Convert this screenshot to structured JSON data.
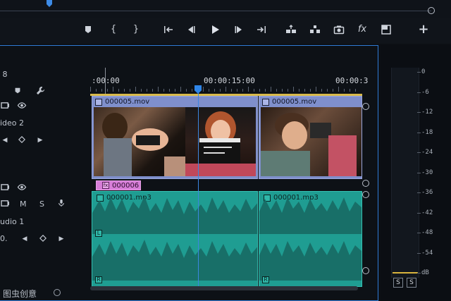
{
  "timecode": {
    "start": ":00:00",
    "mid": "00:00:15:00",
    "end": "00:00:3"
  },
  "tracks": {
    "video2_label": "ideo 2",
    "audio1_label": "udio 1",
    "audio_m": "M",
    "audio_s": "S",
    "audio_volume": "0."
  },
  "clips": {
    "video_a": "000005.mov",
    "video_b": "000005.mov",
    "adjustment": "000006",
    "audio_a": "000001.mp3",
    "audio_b": "000001.mp3",
    "fx": "fx",
    "channel_l": "L",
    "channel_r": "R"
  },
  "meters": {
    "scale": [
      "0",
      "-6",
      "-12",
      "-18",
      "-24",
      "-30",
      "-36",
      "-42",
      "-48",
      "-54",
      "dB"
    ],
    "solo_left": "S",
    "solo_right": "S",
    "peak_color": "#d9b43d"
  },
  "toolbar": {
    "fx_label": "fx"
  },
  "colors": {
    "video_clip": "#7f8fcc",
    "audio_clip": "#1f9d92",
    "adjustment_clip": "#d77ed8",
    "playhead": "#2f86e8",
    "panel_border": "#2f7bd6"
  },
  "watermark": "图虫创意"
}
